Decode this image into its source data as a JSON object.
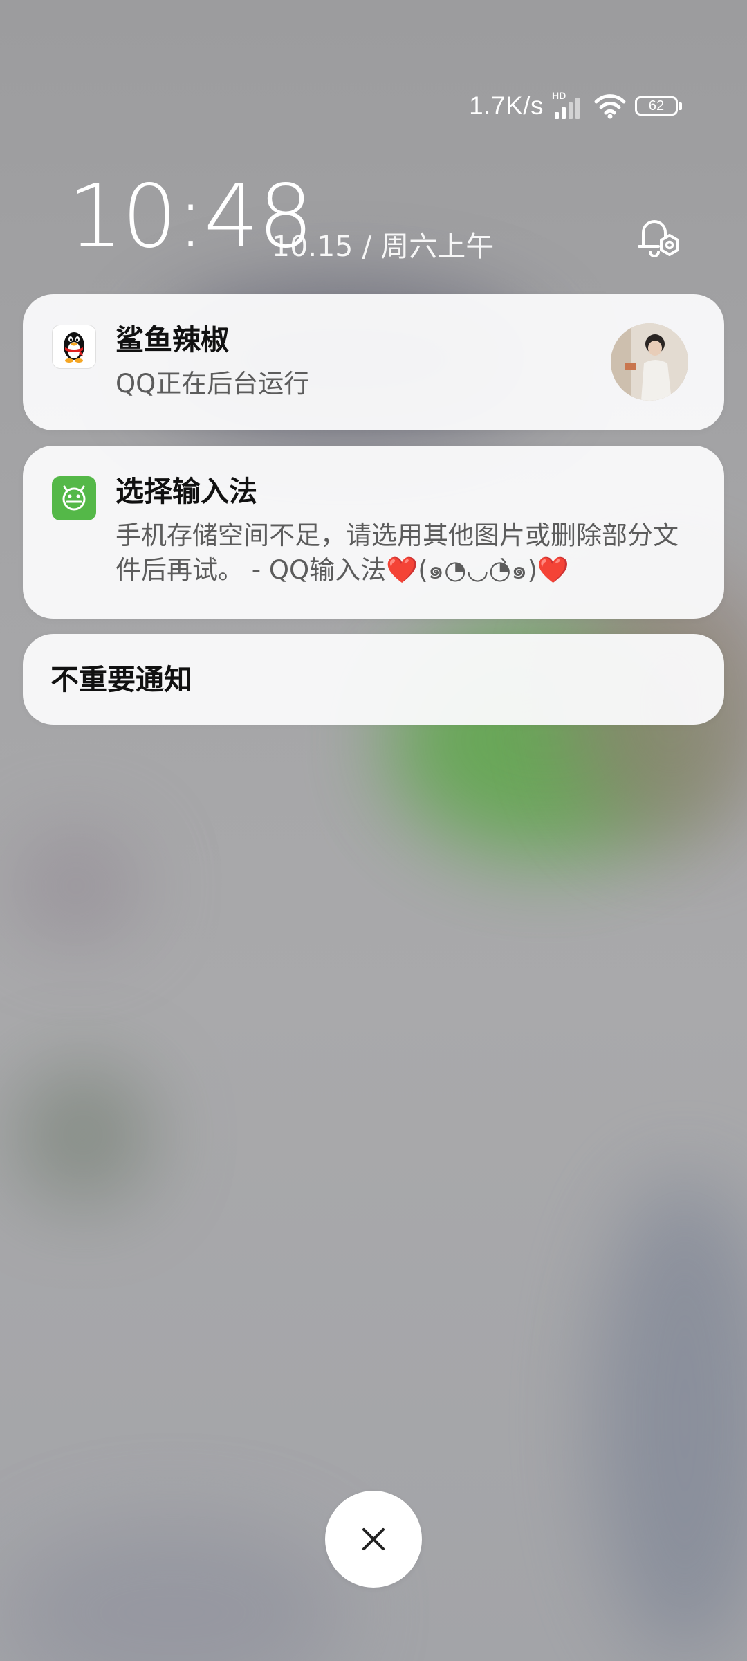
{
  "status_bar": {
    "network_speed": "1.7K/s",
    "hd_label": "HD",
    "battery_level": "62"
  },
  "lock_screen": {
    "time": "10:48",
    "date": "10.15 / 周六上午"
  },
  "notifications": [
    {
      "app_icon": "qq-penguin-icon",
      "title": "鲨鱼辣椒",
      "body": "QQ正在后台运行"
    },
    {
      "app_icon": "android-robot-icon",
      "title": "选择输入法",
      "body": "手机存储空间不足，请选用其他图片或删除部分文件后再试。 - QQ输入法❤️(๑◔◡◔̀๑)❤️"
    }
  ],
  "minor_notifications_label": "不重要通知",
  "colors": {
    "ime_icon_green": "#54b848",
    "card_background": "#f9f9fa",
    "qq_scarf_red": "#e02020"
  }
}
